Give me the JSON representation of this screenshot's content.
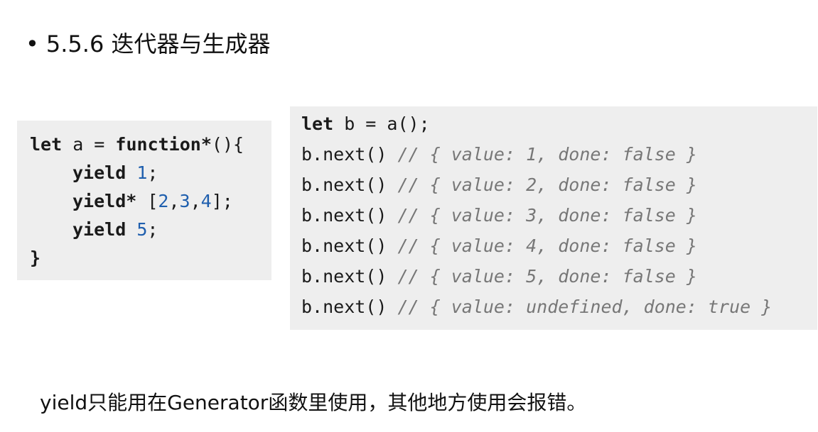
{
  "heading": {
    "bullet": "•",
    "text": "5.5.6 迭代器与生成器"
  },
  "code_left": {
    "l1_let": "let",
    "l1_rest": " a = ",
    "l1_fn": "function*",
    "l1_end": "(){",
    "l2_kw": "yield",
    "l2_num": "1",
    "l2_end": ";",
    "l3_kw": "yield*",
    "l3_open": " [",
    "l3_n1": "2",
    "l3_c1": ",",
    "l3_n2": "3",
    "l3_c2": ",",
    "l3_n3": "4",
    "l3_end": "];",
    "l4_kw": "yield",
    "l4_num": "5",
    "l4_end": ";",
    "l5": "}"
  },
  "code_right": {
    "first_kw": "let",
    "first_rest": " b = a();",
    "calls": [
      {
        "code": "b.next()",
        "comment": " // { value: 1, done: false }"
      },
      {
        "code": "b.next()",
        "comment": " // { value: 2, done: false }"
      },
      {
        "code": "b.next()",
        "comment": " // { value: 3, done: false }"
      },
      {
        "code": "b.next()",
        "comment": " // { value: 4, done: false }"
      },
      {
        "code": "b.next()",
        "comment": " // { value: 5, done: false }"
      },
      {
        "code": "b.next()",
        "comment": " // { value: undefined, done: true }"
      }
    ]
  },
  "note": "yield只能用在Generator函数里使用，其他地方使用会报错。"
}
